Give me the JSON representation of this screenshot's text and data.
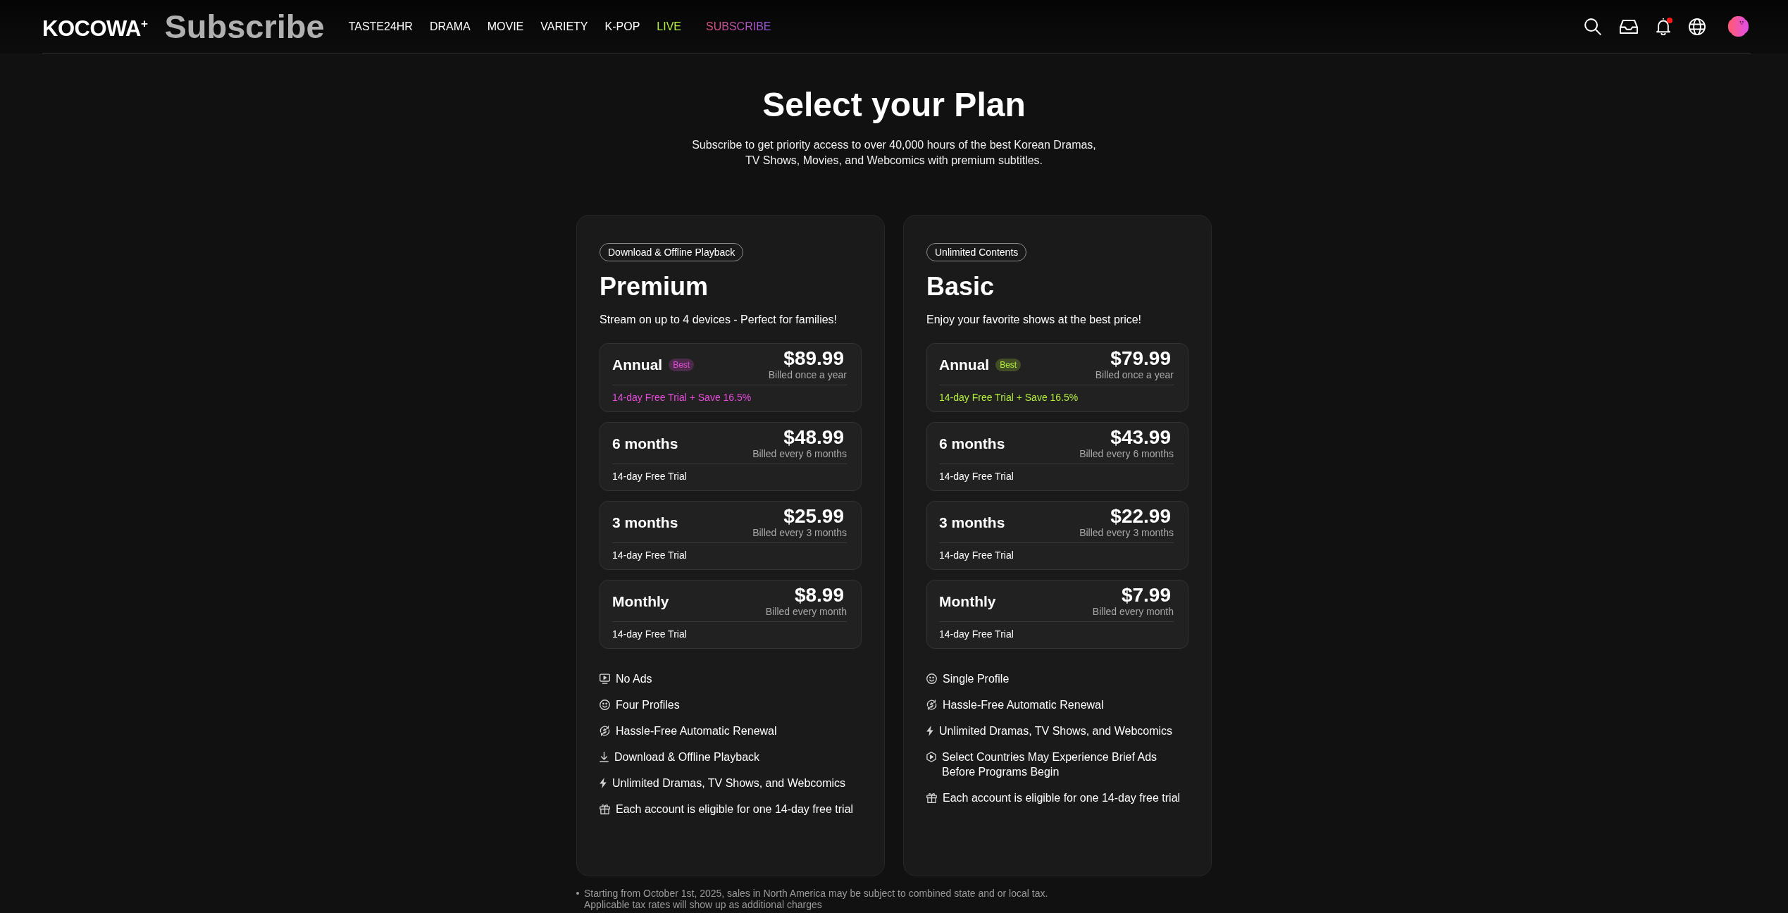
{
  "header": {
    "logo": "KOCOWA$^{+}$",
    "page_heading": "Subscribe",
    "nav": [
      {
        "label": "TASTE24HR",
        "kind": "plain"
      },
      {
        "label": "DRAMA",
        "kind": "plain"
      },
      {
        "label": "MOVIE",
        "kind": "plain"
      },
      {
        "label": "VARIETY",
        "kind": "plain"
      },
      {
        "label": "K-POP",
        "kind": "plain"
      },
      {
        "label": "LIVE",
        "kind": "live"
      },
      {
        "label": "SUBSCRIBE",
        "kind": "subscribe"
      }
    ],
    "notification_unread": true
  },
  "title": "Select your Plan",
  "subtitle": "Subscribe to get priority access to over 40,000 hours of the best Korean Dramas, TV Shows, Movies, and Webcomics with premium subtitles.",
  "plans": [
    {
      "tag": "Download & Offline Playback",
      "name": "Premium",
      "description": "Stream on up to 4 devices - Perfect for families!",
      "color": "#e64ddc",
      "options": [
        {
          "name": "Annual",
          "badge": "Best",
          "price": "$89.99",
          "billing": "Billed once a year",
          "trial": "14-day Free Trial + Save 16.5%",
          "featured": true
        },
        {
          "name": "6 months",
          "price": "$48.99",
          "billing": "Billed every 6 months",
          "trial": "14-day Free Trial",
          "featured": false
        },
        {
          "name": "3 months",
          "price": "$25.99",
          "billing": "Billed every 3 months",
          "trial": "14-day Free Trial",
          "featured": false
        },
        {
          "name": "Monthly",
          "price": "$8.99",
          "billing": "Billed every month",
          "trial": "14-day Free Trial",
          "featured": false
        }
      ],
      "features": [
        {
          "kind": "no-ads",
          "text": "No Ads"
        },
        {
          "kind": "profiles",
          "text": "Four Profiles"
        },
        {
          "kind": "renewal",
          "text": "Hassle-Free Automatic Renewal"
        },
        {
          "kind": "download",
          "text": "Download & Offline Playback"
        },
        {
          "kind": "unlimited",
          "text": "Unlimited Dramas, TV Shows, and Webcomics"
        },
        {
          "kind": "free-trial",
          "text": "Each account is eligible for one 14-day free trial"
        }
      ]
    },
    {
      "tag": "Unlimited Contents",
      "name": "Basic",
      "description": "Enjoy your favorite shows at the best price!",
      "color": "#b4f03c",
      "options": [
        {
          "name": "Annual",
          "badge": "Best",
          "price": "$79.99",
          "billing": "Billed once a year",
          "trial": "14-day Free Trial + Save 16.5%",
          "featured": true
        },
        {
          "name": "6 months",
          "price": "$43.99",
          "billing": "Billed every 6 months",
          "trial": "14-day Free Trial",
          "featured": false
        },
        {
          "name": "3 months",
          "price": "$22.99",
          "billing": "Billed every 3 months",
          "trial": "14-day Free Trial",
          "featured": false
        },
        {
          "name": "Monthly",
          "price": "$7.99",
          "billing": "Billed every month",
          "trial": "14-day Free Trial",
          "featured": false
        }
      ],
      "features": [
        {
          "kind": "profiles",
          "text": "Single Profile"
        },
        {
          "kind": "renewal",
          "text": "Hassle-Free Automatic Renewal"
        },
        {
          "kind": "unlimited",
          "text": "Unlimited Dramas, TV Shows, and Webcomics"
        },
        {
          "kind": "ads-notice",
          "text": "Select Countries May Experience Brief Ads Before Programs Begin"
        },
        {
          "kind": "free-trial",
          "text": "Each account is eligible for one 14-day free trial"
        }
      ]
    }
  ],
  "footnote": {
    "lines": [
      "Starting from October 1st, 2025, sales in North America may be subject to combined state and or local tax.",
      "Applicable tax rates will show up as additional charges"
    ]
  }
}
